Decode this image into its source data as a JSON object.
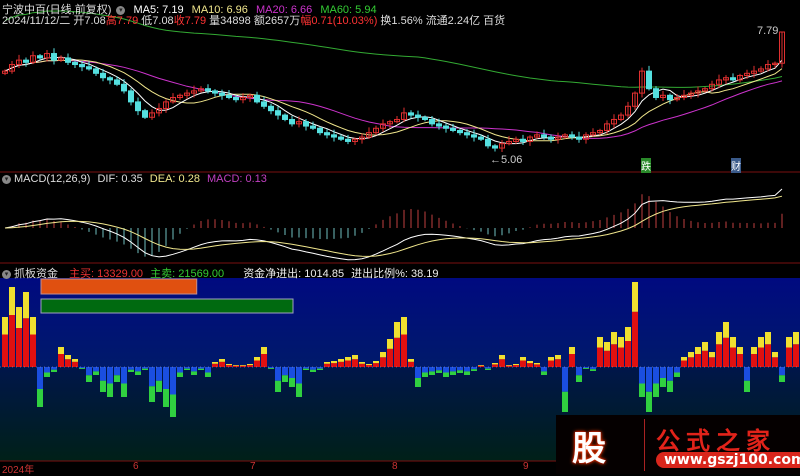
{
  "header": {
    "stock_name": "宁波中百(日线,前复权)",
    "ma5": "MA5: 7.19",
    "ma10": "MA10: 6.96",
    "ma20": "MA20: 6.66",
    "ma60": "MA60: 5.94",
    "date": "2024/11/12/二",
    "open": "开7.08",
    "high_label": "高",
    "high": "7.79",
    "low": "低7.08",
    "close_label": "收",
    "close": "7.79",
    "volume": "量34898",
    "amount": "额2657万",
    "change_label": "幅",
    "change": "0.71(10.03%)",
    "turnover": "换1.56%",
    "float_cap": "流通2.24亿",
    "sector": "百货"
  },
  "price_chart": {
    "high_marker": "7.79",
    "low_marker": "←5.06",
    "events": [
      {
        "label": "跌",
        "color": "#2a8a2a"
      },
      {
        "label": "财",
        "color": "#3a5a8a"
      }
    ],
    "colors": {
      "ma5": "#ffffff",
      "ma10": "#f0e68c",
      "ma20": "#cc33cc",
      "ma60": "#33aa33",
      "up": "#e03030",
      "down": "#55e0e0"
    }
  },
  "macd": {
    "title": "MACD(12,26,9)",
    "dif": "DIF: 0.35",
    "dea": "DEA: 0.28",
    "macd": "MACD: 0.13"
  },
  "fund": {
    "title": "抓板资金",
    "buy_label": "主买: 13329.00",
    "sell_label": "主卖: 21569.00",
    "net_label": "资金净进出: 1014.85",
    "ratio_label": "进出比例%: 38.19",
    "buy_value": 13329.0,
    "sell_value": 21569.0
  },
  "x_axis": {
    "labels": [
      "2024年",
      "6",
      "7",
      "8",
      "9"
    ]
  },
  "logo": {
    "char": "股",
    "brand": "公式之家",
    "url": "www.gszj100.com"
  },
  "chart_data": {
    "type": "candlestick",
    "closes": [
      6.9,
      7.05,
      7.15,
      7.1,
      7.25,
      7.2,
      7.3,
      7.15,
      7.2,
      7.1,
      7.05,
      7.0,
      6.95,
      6.85,
      6.75,
      6.7,
      6.6,
      6.45,
      6.2,
      6.0,
      5.85,
      5.95,
      6.05,
      6.2,
      6.3,
      6.35,
      6.4,
      6.45,
      6.5,
      6.45,
      6.4,
      6.35,
      6.3,
      6.25,
      6.3,
      6.35,
      6.2,
      6.1,
      6.0,
      5.9,
      5.8,
      5.7,
      5.75,
      5.65,
      5.6,
      5.5,
      5.45,
      5.4,
      5.35,
      5.3,
      5.35,
      5.4,
      5.5,
      5.6,
      5.7,
      5.75,
      5.8,
      5.95,
      5.9,
      5.85,
      5.8,
      5.7,
      5.65,
      5.6,
      5.55,
      5.5,
      5.45,
      5.4,
      5.35,
      5.2,
      5.15,
      5.25,
      5.3,
      5.35,
      5.3,
      5.4,
      5.45,
      5.4,
      5.35,
      5.4,
      5.45,
      5.4,
      5.35,
      5.45,
      5.5,
      5.55,
      5.7,
      5.8,
      5.9,
      6.1,
      6.4,
      6.9,
      6.5,
      6.3,
      6.35,
      6.25,
      6.3,
      6.35,
      6.4,
      6.45,
      6.5,
      6.6,
      6.7,
      6.75,
      6.7,
      6.8,
      6.85,
      6.9,
      6.95,
      7.05,
      7.08,
      7.79
    ],
    "price_range": [
      5.06,
      7.79
    ],
    "fund_net": [
      50,
      80,
      60,
      75,
      50,
      -40,
      -10,
      -5,
      20,
      12,
      8,
      -2,
      -15,
      -8,
      -25,
      -30,
      -15,
      -30,
      -5,
      -8,
      -3,
      -35,
      -25,
      -40,
      -50,
      -10,
      -3,
      -8,
      -3,
      -10,
      5,
      8,
      3,
      2,
      2,
      3,
      10,
      20,
      -2,
      -25,
      -15,
      -20,
      -30,
      -3,
      -5,
      -3,
      5,
      6,
      8,
      10,
      12,
      5,
      3,
      6,
      15,
      28,
      45,
      50,
      8,
      -20,
      -10,
      -8,
      -6,
      -10,
      -8,
      -6,
      -8,
      -4,
      2,
      -3,
      4,
      12,
      2,
      3,
      10,
      6,
      4,
      -8,
      10,
      12,
      -45,
      20,
      -15,
      -2,
      -4,
      30,
      25,
      35,
      30,
      40,
      85,
      -30,
      -45,
      -30,
      -20,
      -25,
      -10,
      10,
      15,
      20,
      25,
      15,
      35,
      45,
      30,
      20,
      -25,
      20,
      30,
      35,
      15,
      -15,
      30,
      35
    ]
  }
}
